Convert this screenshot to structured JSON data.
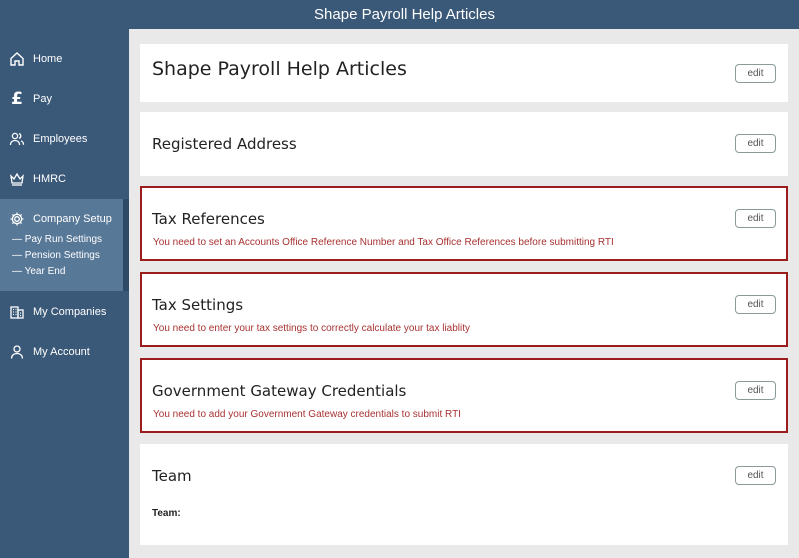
{
  "header": {
    "title": "Shape Payroll Help Articles"
  },
  "sidebar": {
    "items": [
      {
        "label": "Home",
        "icon": "home-icon"
      },
      {
        "label": "Pay",
        "icon": "pound-icon",
        "glyph": "£"
      },
      {
        "label": "Employees",
        "icon": "users-icon"
      },
      {
        "label": "HMRC",
        "icon": "crown-icon"
      },
      {
        "label": "Company Setup",
        "icon": "gear-icon"
      },
      {
        "label": "My Companies",
        "icon": "building-icon"
      },
      {
        "label": "My Account",
        "icon": "user-icon"
      }
    ],
    "subitems": [
      "— Pay Run Settings",
      "— Pension Settings",
      "— Year End"
    ]
  },
  "cards": {
    "title_card": {
      "title": "Shape Payroll Help Articles",
      "edit": "edit"
    },
    "address": {
      "title": "Registered Address",
      "edit": "edit"
    },
    "tax_refs": {
      "title": "Tax References",
      "edit": "edit",
      "warning": "You need to set an Accounts Office Reference Number and Tax Office References before submitting RTI"
    },
    "tax_settings": {
      "title": "Tax Settings",
      "edit": "edit",
      "warning": "You need to enter your tax settings to correctly calculate your tax liablity"
    },
    "gateway": {
      "title": "Government Gateway Credentials",
      "edit": "edit",
      "warning": "You need to add your Government Gateway credentials to submit RTI"
    },
    "team": {
      "title": "Team",
      "edit": "edit",
      "label": "Team:"
    }
  },
  "colors": {
    "brand": "#3a5878",
    "active": "#587898",
    "warning": "#9b1c1c"
  }
}
